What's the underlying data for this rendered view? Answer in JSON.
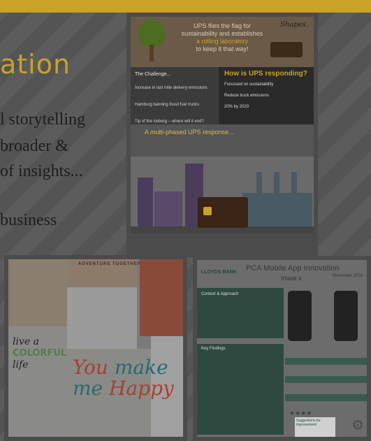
{
  "slide": {
    "heading_partial": "ation",
    "lines": [
      "l storytelling",
      "broader &",
      " of insights...",
      "",
      "business"
    ]
  },
  "ups_infographic": {
    "header_text": "UPS flies the flag for sustainability and establishes",
    "header_accent": "a rolling laboratory",
    "header_end": "to keep it that way!",
    "signature": "Shapes.",
    "challenge_title": "The Challenge...",
    "challenges": [
      "Increase in last mile delivery emissions",
      "Hamburg banning fossil fuel trucks",
      "Tip of the iceberg – where will it end?"
    ],
    "responding_title": "How is UPS responding?",
    "responding_items": [
      "Focussed on sustainability",
      "Reduce truck emissions",
      "20% by 2020"
    ],
    "response_title": "A multi-phased UPS response..."
  },
  "collage": {
    "ad_text": "ADVENTURE TOGETHER",
    "live_text_1": "live a",
    "live_text_col": "COLORFUL",
    "live_text_2": "life",
    "ymmh_1": "You",
    "ymmh_2": "make",
    "ymmh_3": "me",
    "ymmh_4": "Happy"
  },
  "lloyds": {
    "brand": "LLOYDS BANK",
    "title": "PCA Mobile App Innovation",
    "stage": "STAGE 3",
    "date": "November 2014",
    "context_title": "Context & Approach",
    "key_findings_title": "Key Findings",
    "sfi_title": "Suggestions for improvement"
  }
}
